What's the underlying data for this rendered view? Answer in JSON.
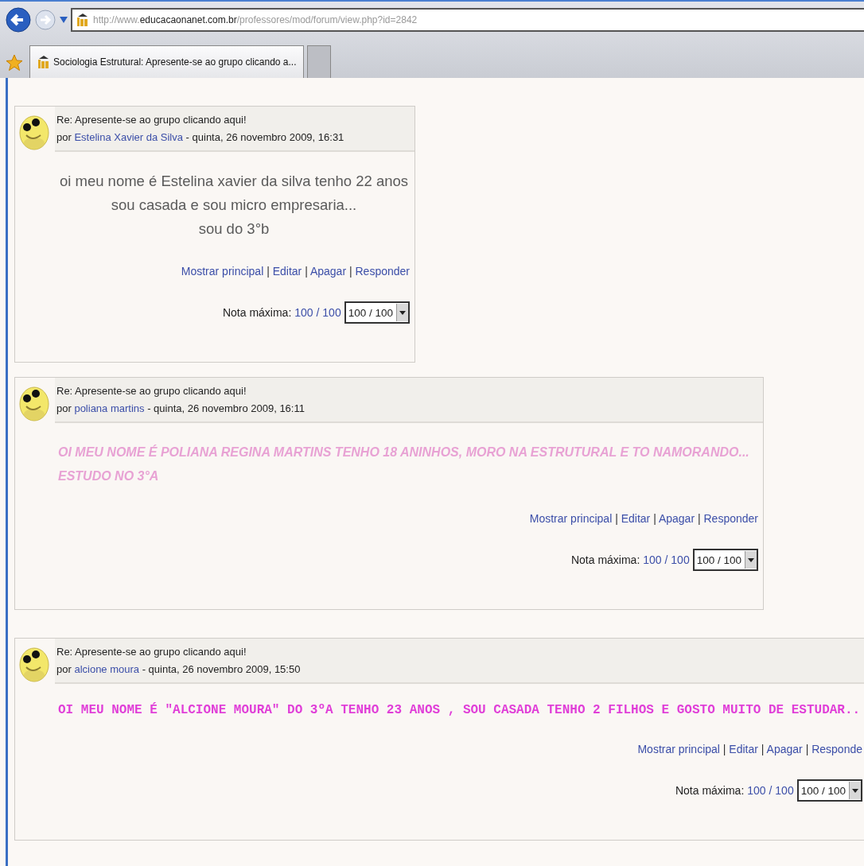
{
  "browser": {
    "address": {
      "domain_prefix": "http://www.",
      "domain": "educacaonanet.com.br",
      "path": "/professores/mod/forum/view.php?id=2842"
    },
    "tabs": [
      {
        "title": "Sociologia Estrutural: Apresente-se ao grupo clicando a...",
        "selected": true
      },
      {
        "selected": false
      }
    ]
  },
  "action_separator": "|",
  "posts": [
    {
      "subject": "Re: Apresente-se ao grupo clicando aqui!",
      "by": "por",
      "author": "Estelina Xavier da Silva",
      "date": "- quinta, 26 novembro 2009, 16:31",
      "kind": "centered",
      "message": [
        "oi meu nome é Estelina xavier da silva tenho 22 anos",
        "sou casada e sou micro empresaria...",
        "sou do 3°b"
      ],
      "actions": [
        "Mostrar principal",
        "Editar",
        "Apagar",
        "Responder"
      ],
      "grade_label": "Nota máxima:",
      "grade_link": "100 / 100",
      "grade_select": "100 / 100"
    },
    {
      "subject": "Re: Apresente-se ao grupo clicando aqui!",
      "by": "por",
      "author": "poliana martins",
      "date": "- quinta, 26 novembro 2009, 16:11",
      "kind": "italic-caps",
      "message": [
        "OI MEU NOME É POLIANA REGINA MARTINS TENHO 18 ANINHOS, MORO NA ESTRUTURAL E TO NAMORANDO...",
        "ESTUDO NO 3°A"
      ],
      "actions": [
        "Mostrar principal",
        "Editar",
        "Apagar",
        "Responder"
      ],
      "grade_label": "Nota máxima:",
      "grade_link": "100 / 100",
      "grade_select": "100 / 100"
    },
    {
      "subject": "Re: Apresente-se ao grupo clicando aqui!",
      "by": "por",
      "author": "alcione moura",
      "date": "- quinta, 26 novembro 2009, 15:50",
      "kind": "mono",
      "message": [
        "OI MEU NOME É \"ALCIONE MOURA\" DO 3ºA TENHO 23 ANOS , SOU CASADA TENHO 2 FILHOS E GOSTO MUITO DE ESTUDAR.."
      ],
      "actions": [
        "Mostrar principal",
        "Editar",
        "Apagar",
        "Responde"
      ],
      "grade_label": "Nota máxima:",
      "grade_link": "100 / 100",
      "grade_select": "100 / 100"
    }
  ]
}
